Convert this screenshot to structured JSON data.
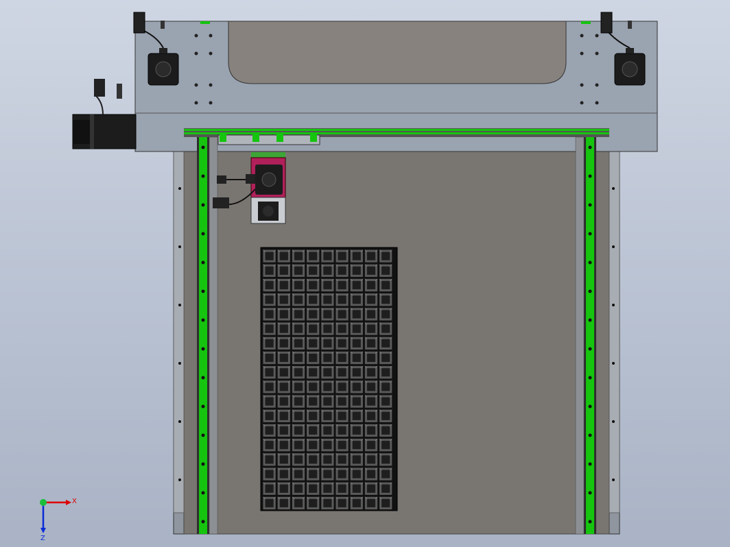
{
  "scene": {
    "description_colors": {
      "background_top": "#cfd6e3",
      "background_bottom": "#a9b3c5",
      "frame": "#9aa3b0",
      "bed": "#797672",
      "rail_green": "#16c40f",
      "motor_black": "#1c1c1c",
      "carriage_magenta": "#b0205a",
      "tray_cell": "#2a2a2a"
    },
    "tray": {
      "rows": 18,
      "cols": 9
    },
    "triad": {
      "x_label": "X",
      "z_label": "Z"
    }
  }
}
